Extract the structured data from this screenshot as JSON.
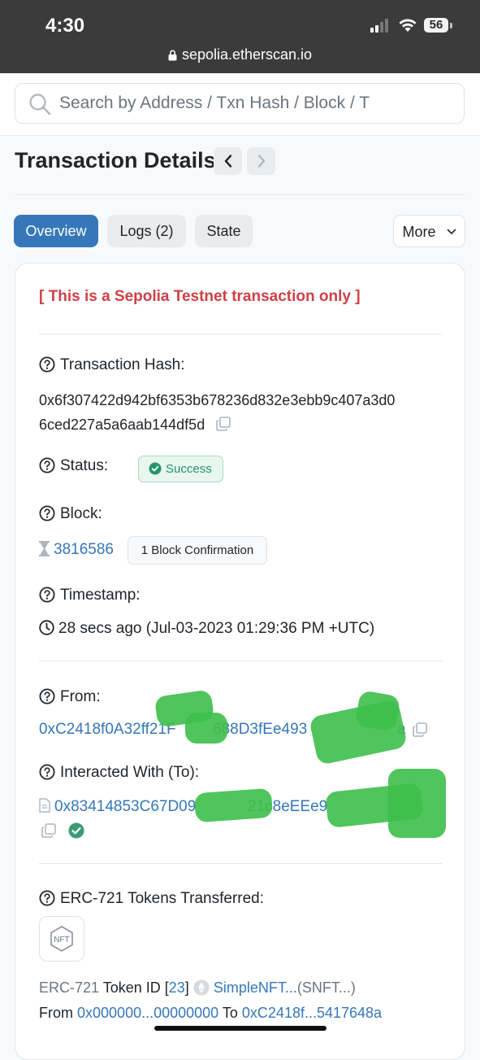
{
  "status_bar": {
    "time": "4:30",
    "battery": "56",
    "url": "sepolia.etherscan.io"
  },
  "search": {
    "placeholder": "Search by Address / Txn Hash / Block / T"
  },
  "page": {
    "title": "Transaction Details"
  },
  "tabs": [
    {
      "label": "Overview",
      "active": true
    },
    {
      "label": "Logs (2)",
      "active": false
    },
    {
      "label": "State",
      "active": false
    },
    {
      "label": "More",
      "active": false
    }
  ],
  "details": {
    "notice": "[ This is a Sepolia Testnet transaction only ]",
    "tx_hash": {
      "label": "Transaction Hash:",
      "value_line1": "0x6f307422d942bf6353b678236d832e3ebb9c407a3d0",
      "value_line2": "6ced227a5a6aab144df5d"
    },
    "status": {
      "label": "Status:",
      "value": "Success"
    },
    "block": {
      "label": "Block:",
      "number": "3816586",
      "confirmations": "1 Block Confirmation"
    },
    "timestamp": {
      "label": "Timestamp:",
      "value": "28 secs ago (Jul-03-2023 01:29:36 PM +UTC)"
    },
    "from": {
      "label": "From:",
      "address_visible": "0xC2418f0A32ff21F",
      "address_mid": "688D3fEe493",
      "address_end": "a"
    },
    "to": {
      "label": "Interacted With (To):",
      "address_visible": "0x83414853C67D09",
      "address_mid": "21c8eEEe9"
    },
    "tokens": {
      "label": "ERC-721 Tokens Transferred:",
      "nft_badge": "NFT",
      "standard": "ERC-721",
      "token_id_prefix": "Token ID [",
      "token_id": "23",
      "token_id_suffix": "]",
      "token_name": "SimpleNFT...",
      "token_symbol": "(SNFT...)",
      "from_label": "From",
      "from_address": "0x000000...00000000",
      "to_label": "To",
      "to_address": "0xC2418f...5417648a"
    }
  },
  "colors": {
    "accent": "#3577b9",
    "success": "#24956a",
    "danger": "#d13f46",
    "status_bar": "#3b3b3b"
  }
}
